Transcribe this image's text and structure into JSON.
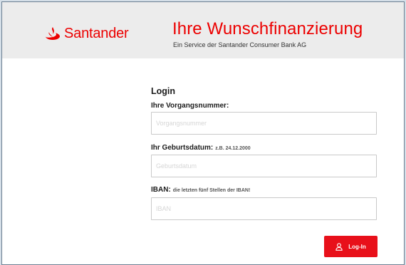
{
  "header": {
    "logo_text": "Santander",
    "title": "Ihre Wunschfinanzierung",
    "subtitle": "Ein Service der Santander Consumer Bank AG"
  },
  "login": {
    "title": "Login",
    "vorgangsnummer": {
      "label": "Ihre Vorgangsnummer:",
      "hint": "",
      "placeholder": "Vorgangsnummer"
    },
    "geburtsdatum": {
      "label": "Ihr Geburtsdatum:",
      "hint": "z.B. 24.12.2000",
      "placeholder": "Geburtsdatum"
    },
    "iban": {
      "label": "IBAN:",
      "hint": "die letzten fünf Stellen der IBAN!",
      "placeholder": "IBAN"
    },
    "button_label": "Log-In"
  },
  "colors": {
    "brand_red": "#ec0000",
    "header_bg": "#ececec",
    "outer_bg": "#d5dfe8"
  },
  "icons": {
    "logo": "santander-flame-icon",
    "button": "user-icon"
  }
}
